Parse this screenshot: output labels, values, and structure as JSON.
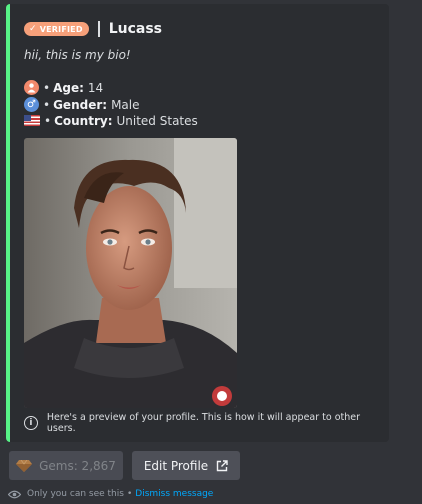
{
  "embed": {
    "accent_color": "#57f287",
    "badge_label": "VERIFIED",
    "username": "Lucass",
    "bio": "hii, this is my bio!",
    "fields": [
      {
        "icon": "person-icon",
        "label": "Age:",
        "value": "14"
      },
      {
        "icon": "male-sign-icon",
        "label": "Gender:",
        "value": "Male"
      },
      {
        "icon": "us-flag-icon",
        "label": "Country:",
        "value": "United States"
      }
    ],
    "footer_text": "Here's a preview of your profile. This is how it will appear to other users."
  },
  "buttons": {
    "gems_label": "Gems: 2,867",
    "edit_label": "Edit Profile"
  },
  "ephemeral": {
    "notice": "Only you can see this",
    "separator": "•",
    "dismiss": "Dismiss message"
  }
}
